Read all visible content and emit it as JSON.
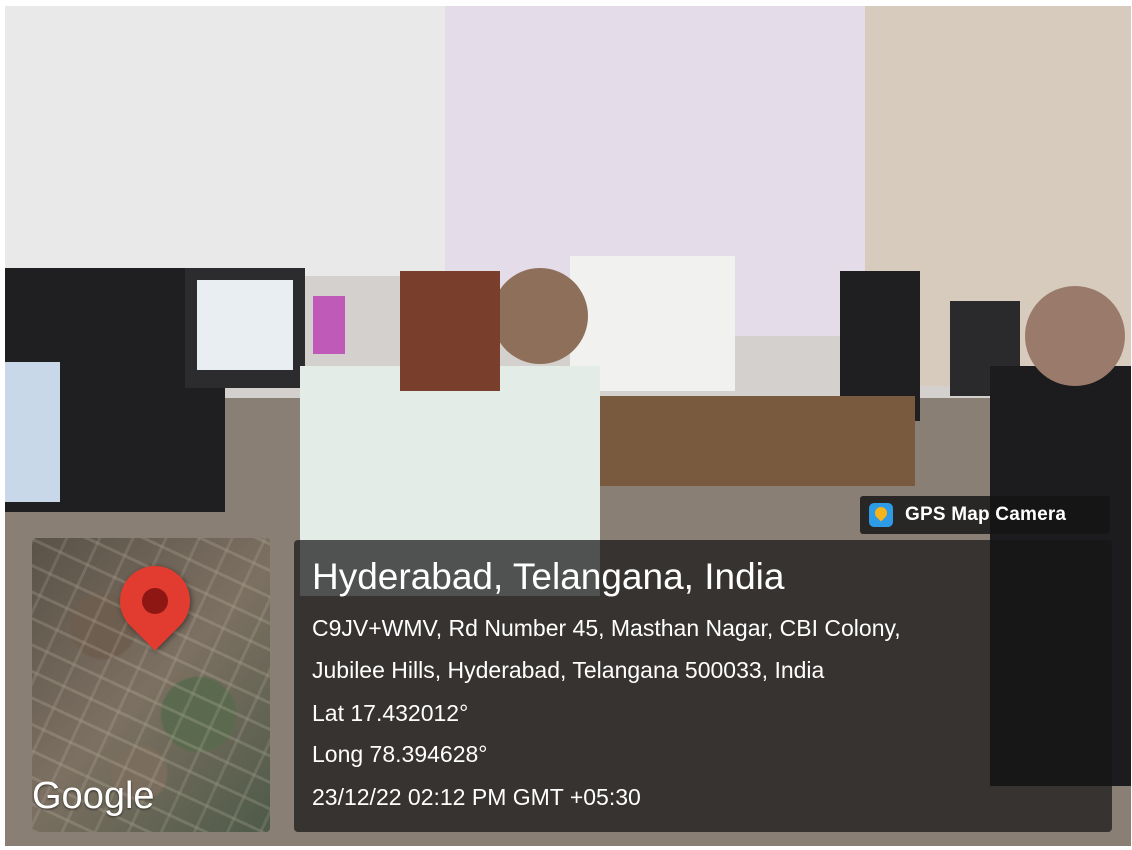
{
  "badge": {
    "label": "GPS Map Camera",
    "icon": "gps-map-camera-app-icon"
  },
  "map": {
    "brand": "Google",
    "marker_icon": "location-pin-icon",
    "marker_color": "#e23b2f"
  },
  "location": {
    "title": "Hyderabad, Telangana, India",
    "address_line1": "C9JV+WMV, Rd Number 45, Masthan Nagar, CBI Colony,",
    "address_line2": "Jubilee Hills, Hyderabad, Telangana 500033, India",
    "latitude": "Lat 17.432012°",
    "longitude": "Long 78.394628°",
    "datetime": "23/12/22 02:12 PM GMT +05:30"
  }
}
